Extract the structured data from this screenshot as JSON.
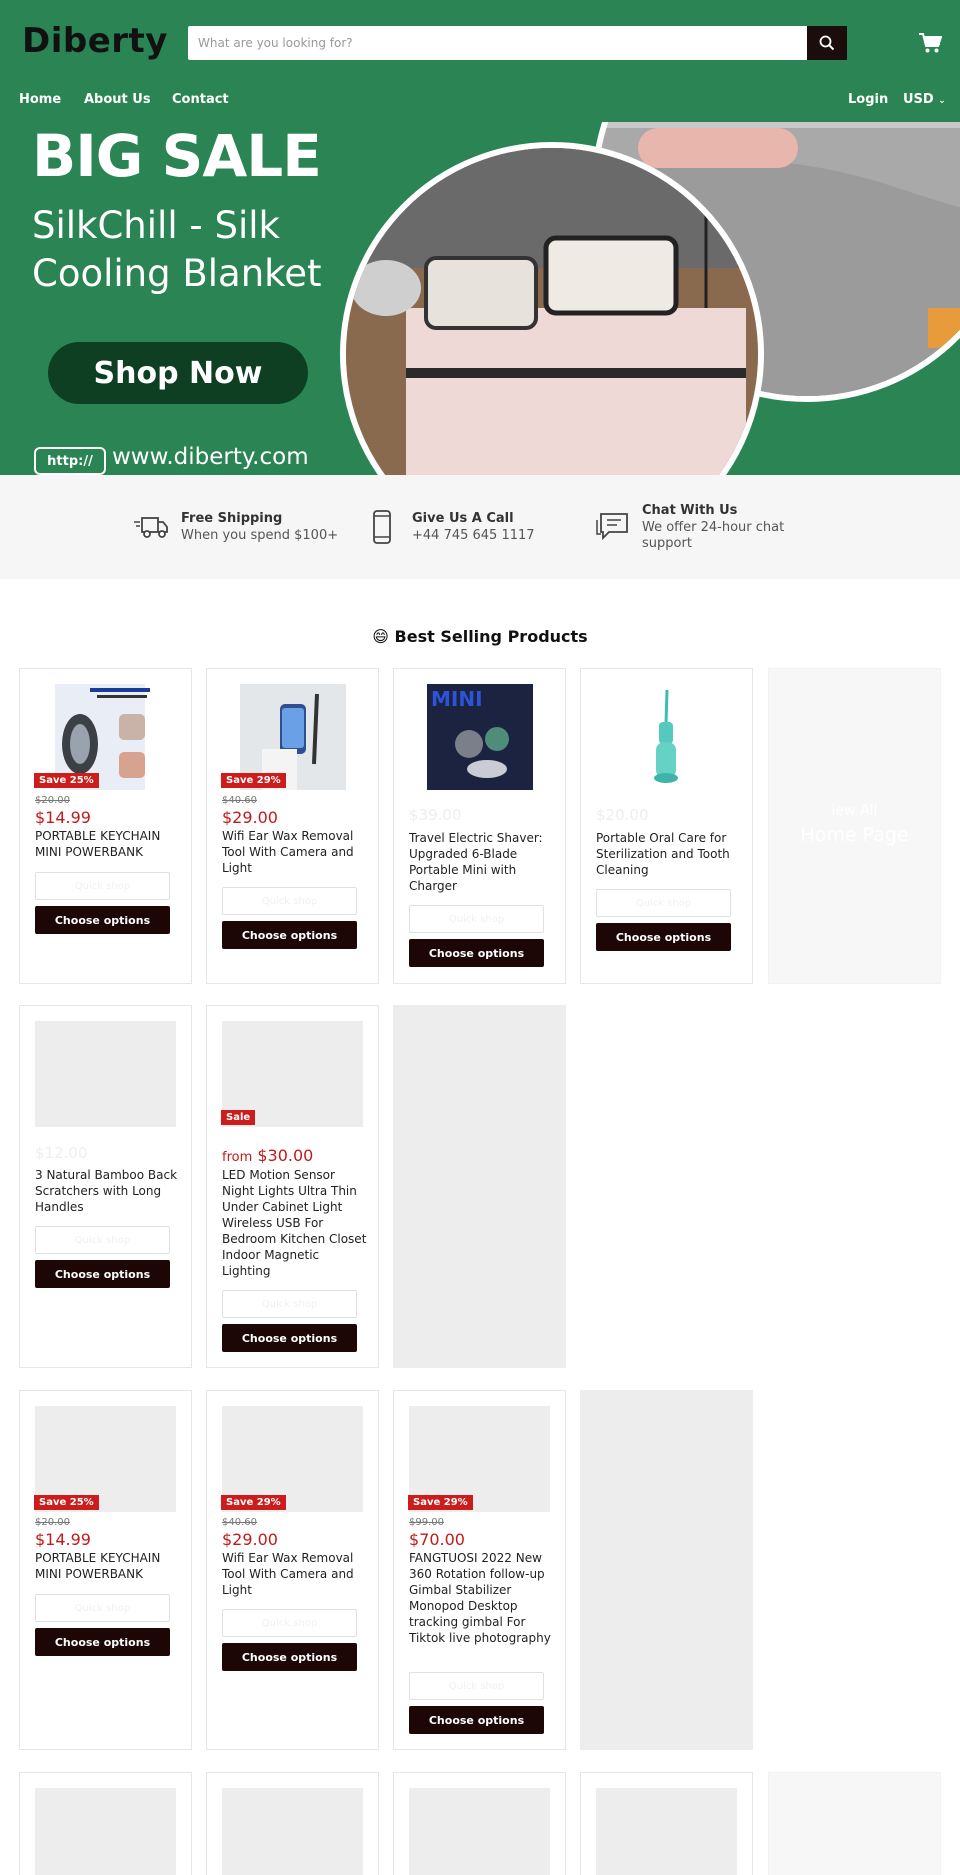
{
  "header": {
    "logo_text": "Diberty",
    "search_placeholder": "What are you looking for?",
    "nav": [
      "Home",
      "About Us",
      "Contact"
    ],
    "login": "Login",
    "currency": "USD"
  },
  "hero": {
    "title": "BIG SALE",
    "subtitle": "SilkChill - Silk Cooling Blanket",
    "button": "Shop Now",
    "url_box": "http://",
    "url": "www.diberty.com"
  },
  "features": [
    {
      "title": "Free Shipping",
      "sub": "When you spend $100+",
      "icon": "truck-icon"
    },
    {
      "title": "Give Us A Call",
      "sub": "+44 745 645 1117",
      "icon": "phone-icon"
    },
    {
      "title": "Chat With Us",
      "sub": "We offer 24-hour chat support",
      "icon": "chat-icon"
    }
  ],
  "section_title": "😄 Best Selling Products",
  "ghost_card": {
    "line1": "iew All",
    "line2": "Home Page"
  },
  "products": [
    {
      "badge": "Save 25%",
      "compare": "$20.00",
      "price": "$14.99",
      "title": "PORTABLE KEYCHAIN MINI POWERBANK",
      "quick": "Quick shop",
      "choose": "Choose options"
    },
    {
      "badge": "Save 29%",
      "compare": "$40.60",
      "price": "$29.00",
      "title": "Wifi Ear Wax Removal Tool With Camera and Light",
      "quick": "Quick shop",
      "choose": "Choose options"
    },
    {
      "price_ghost": "$39.00",
      "title": "Travel Electric Shaver: Upgraded 6-Blade Portable Mini with Charger",
      "quick": "Quick shop",
      "choose": "Choose options"
    },
    {
      "price_ghost": "$20.00",
      "title": "Portable Oral Care for Sterilization and Tooth Cleaning",
      "quick": "Quick shop",
      "choose": "Choose options"
    },
    {
      "price_ghost": "$12.00",
      "title": "3 Natural Bamboo Back Scratchers with Long Handles",
      "quick": "Quick shop",
      "choose": "Choose options"
    },
    {
      "badge": "Sale",
      "from": "from",
      "price": "$30.00",
      "title": "LED Motion Sensor Night Lights Ultra Thin Under Cabinet Light Wireless USB For Bedroom Kitchen Closet Indoor Magnetic Lighting",
      "quick": "Quick shop",
      "choose": "Choose options"
    },
    {
      "badge": "Save 25%",
      "compare": "$20.00",
      "price": "$14.99",
      "title": "PORTABLE KEYCHAIN MINI POWERBANK",
      "quick": "Quick shop",
      "choose": "Choose options"
    },
    {
      "badge": "Save 29%",
      "compare": "$40.60",
      "price": "$29.00",
      "title": "Wifi Ear Wax Removal Tool With Camera and Light",
      "quick": "Quick shop",
      "choose": "Choose options"
    },
    {
      "badge": "Save 29%",
      "compare": "$99.00",
      "price": "$70.00",
      "title": "FANGTUOSI 2022 New 360 Rotation follow-up Gimbal Stabilizer Monopod Desktop tracking gimbal For Tiktok live photography",
      "quick": "Quick shop",
      "choose": "Choose options"
    }
  ],
  "colors": {
    "brand_green": "#2a8454",
    "dark_button": "#1c0606",
    "sale_red": "#cc1c1c"
  }
}
